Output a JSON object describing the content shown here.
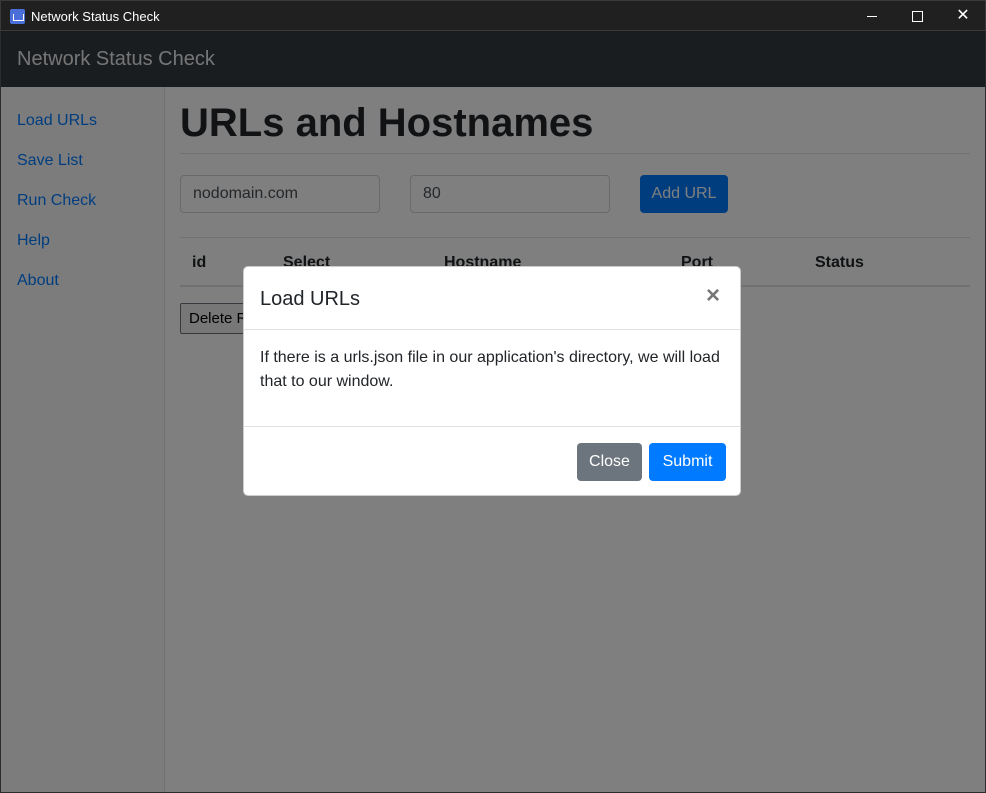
{
  "window": {
    "title": "Network Status Check"
  },
  "navbar": {
    "brand": "Network Status Check"
  },
  "sidebar": {
    "items": [
      {
        "label": "Load URLs"
      },
      {
        "label": "Save List"
      },
      {
        "label": "Run Check"
      },
      {
        "label": "Help"
      },
      {
        "label": "About"
      }
    ]
  },
  "main": {
    "title": "URLs and Hostnames",
    "hostname_input": {
      "value": "nodomain.com"
    },
    "port_input": {
      "value": "80"
    },
    "add_button": "Add URL",
    "table": {
      "columns": [
        "id",
        "Select",
        "Hostname",
        "Port",
        "Status"
      ]
    },
    "delete_button": "Delete R"
  },
  "modal": {
    "title": "Load URLs",
    "close_symbol": "×",
    "body": "If there is a urls.json file in our application's directory, we will load that to our window.",
    "close_button": "Close",
    "submit_button": "Submit"
  },
  "colors": {
    "primary": "#007bff",
    "secondary": "#6c757d",
    "navbar": "#343a40"
  }
}
